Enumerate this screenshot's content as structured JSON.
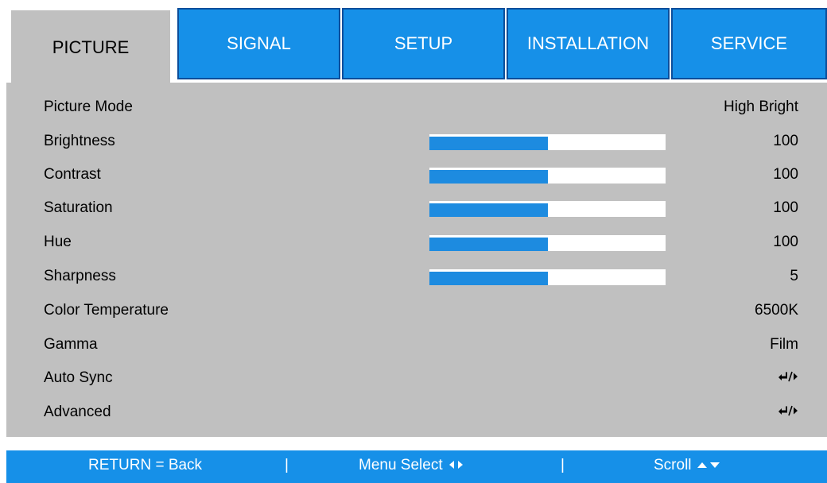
{
  "tabs": [
    {
      "label": "PICTURE",
      "active": true
    },
    {
      "label": "SIGNAL",
      "active": false
    },
    {
      "label": "SETUP",
      "active": false
    },
    {
      "label": "INSTALLATION",
      "active": false
    },
    {
      "label": "SERVICE",
      "active": false
    }
  ],
  "rows": [
    {
      "label": "Picture Mode",
      "value": "High Bright"
    },
    {
      "label": "Brightness",
      "value": "100",
      "bar_level": 0.5
    },
    {
      "label": "Contrast",
      "value": "100",
      "bar_level": 0.5
    },
    {
      "label": "Saturation",
      "value": "100",
      "bar_level": 0.5
    },
    {
      "label": "Hue",
      "value": "100",
      "bar_level": 0.5
    },
    {
      "label": "Sharpness",
      "value": "5",
      "bar_level": 0.5
    },
    {
      "label": "Color Temperature",
      "value": "6500K"
    },
    {
      "label": "Gamma",
      "value": "Film"
    },
    {
      "label": "Auto Sync",
      "value": "",
      "icon": "enter-right-icon"
    },
    {
      "label": "Advanced",
      "value": "",
      "icon": "enter-right-icon"
    }
  ],
  "footer": {
    "return_text": "RETURN = Back",
    "separator": "|",
    "menu_select_text": "Menu Select",
    "scroll_text": "Scroll"
  },
  "colors": {
    "accent": "#1690e8",
    "panel": "#c0c0c0",
    "bar_fill": "#1d8be0"
  }
}
